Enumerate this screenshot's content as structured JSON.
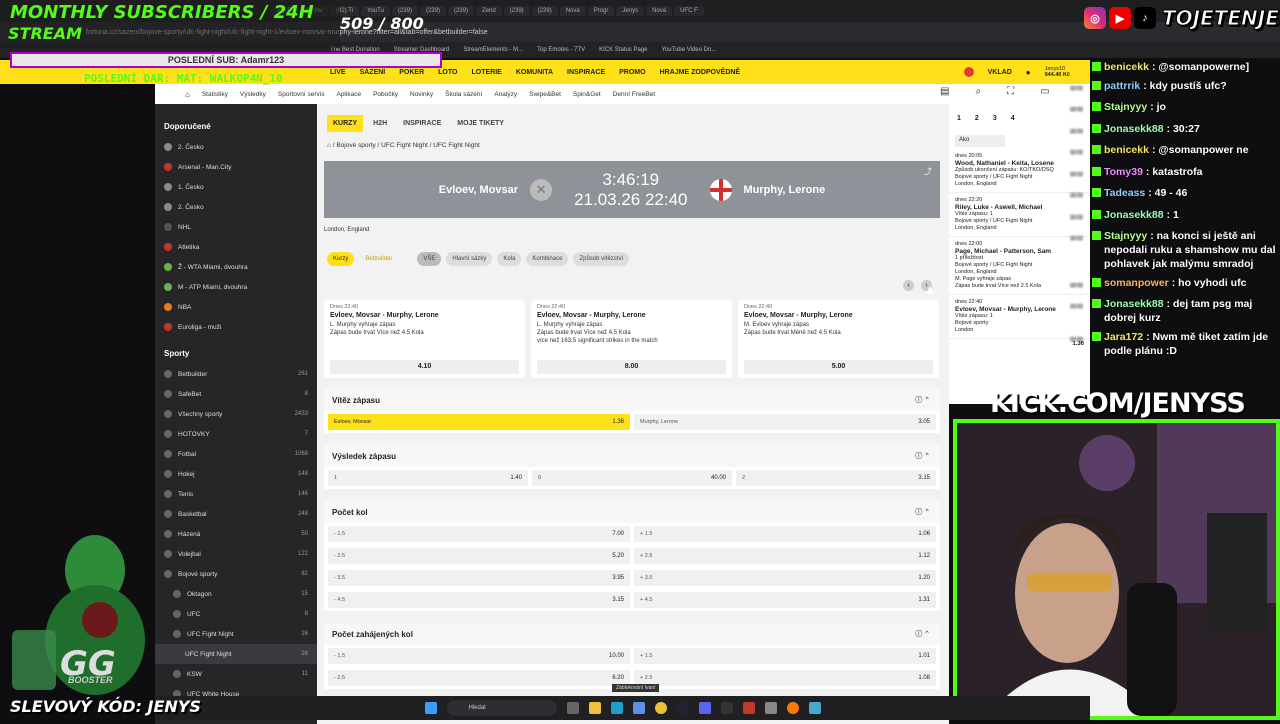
{
  "overlay": {
    "subs_title": "MONTHLY SUBSCRIBERS / 24H",
    "subs_stream": "STREAM",
    "subs_count": "509 / 800",
    "progress_label": "POSLEDNÍ SUB: Adamr123",
    "last_donation": "POSLEDNÍ DAR: MAT: WALKOP4N_10",
    "socials_handle": "TOJETENJENYS",
    "kick": "KICK.COM/JENYSS",
    "discount": "SLEVOVÝ KÓD: JENYS",
    "booster": "BOOSTER"
  },
  "browser": {
    "url": "fortuna.cz/sazeni/bojove-sporty/ufc-fight-night/ufc-fight-night-1/evloev-movsar-murphy-lerone?filter=all&tab=offer&betbuilder=false",
    "tabs": [
      "Top B",
      "(9) inv",
      "(82) Ti",
      "YouTu",
      "(239)",
      "(239)",
      "(239)",
      "Zend",
      "(239)",
      "(239)",
      "Nová",
      "Progr",
      "Jenys",
      "Nová",
      "UFC F"
    ],
    "bookmarks": [
      "The Best Donation",
      "Streamer Dashboard",
      "StreamElements - M...",
      "Top Emotes - 7TV",
      "KICK Status Page",
      "YouTube Video Do..."
    ]
  },
  "site": {
    "nav": [
      "LIVE",
      "SÁZENÍ",
      "POKER",
      "LOTO",
      "LOTERIE",
      "KOMUNITA",
      "INSPIRACE",
      "PROMO",
      "HRAJME ZODPOVĚDNĚ"
    ],
    "deposit": "VKLAD",
    "balance": "944.40 Kč",
    "user": "Jenys10",
    "subnav": [
      "Statistiky",
      "Výsledky",
      "Sportovní servis",
      "Aplikace",
      "Pobočky",
      "Novinky",
      "Škola sázení",
      "Analýzy",
      "Swipe&Bet",
      "Spin&Get",
      "Denní FreeBet"
    ]
  },
  "sidebar": {
    "recommended_title": "Doporučené",
    "recommended": [
      "2. Česko",
      "Arsenal - Man.City",
      "1. Česko",
      "2. Česko",
      "NHL",
      "Atletika",
      "Ž - WTA Miami, dvouhra",
      "M - ATP Miami, dvouhra",
      "NBA",
      "Euroliga - muži"
    ],
    "sports_title": "Sporty",
    "sports": [
      {
        "label": "Betbuilder",
        "count": "261"
      },
      {
        "label": "SafeBet",
        "count": "8"
      },
      {
        "label": "Všechny sporty",
        "count": "2433"
      },
      {
        "label": "HOTOVKY",
        "count": "7"
      },
      {
        "label": "Fotbal",
        "count": "1068"
      },
      {
        "label": "Hokej",
        "count": "148"
      },
      {
        "label": "Tenis",
        "count": "146"
      },
      {
        "label": "Basketbal",
        "count": "248"
      },
      {
        "label": "Házená",
        "count": "50"
      },
      {
        "label": "Volejbal",
        "count": "122"
      },
      {
        "label": "Bojové sporty",
        "count": "82"
      },
      {
        "label": "Oktagon",
        "count": "15"
      },
      {
        "label": "UFC",
        "count": "8"
      },
      {
        "label": "UFC Fight Night",
        "count": "26"
      },
      {
        "label": "UFC Fight Night",
        "count": "26"
      },
      {
        "label": "KSW",
        "count": "11"
      },
      {
        "label": "UFC White House",
        "count": ""
      }
    ]
  },
  "main": {
    "tabs": [
      "KURZY",
      "H2H",
      "INSPIRACE",
      "MOJE TIKETY"
    ],
    "breadcrumb": [
      "Bojové sporty",
      "UFC Fight Night",
      "UFC Fight Night"
    ],
    "player1": "Evloev, Movsar",
    "player2": "Murphy, Lerone",
    "countdown": "3:46:19",
    "datetime": "21.03.26 22:40",
    "location": "London, England",
    "mode_kurzy": "Kurzy",
    "mode_bb": "Betbuilder",
    "filters": [
      "VŠE",
      "Hlavní sázky",
      "Kola",
      "Kombinace",
      "Způsob vítězství"
    ],
    "bb_cards": [
      {
        "when": "Dnes 22:40",
        "event": "Evloev, Movsar - Murphy, Lerone",
        "legs": [
          "L. Murphy vyhraje zápas",
          "Zápas bude trvat Více než 4.5 Kola"
        ],
        "odd": "4.10"
      },
      {
        "when": "Dnes 22:40",
        "event": "Evloev, Movsar - Murphy, Lerone",
        "legs": [
          "L. Murphy vyhraje zápas",
          "Zápas bude trvat Více než 4.5 Kola",
          "více než 163.5 significant strikes in the match"
        ],
        "odd": "8.00"
      },
      {
        "when": "Dnes 22:40",
        "event": "Evloev, Movsar - Murphy, Lerone",
        "legs": [
          "M. Evloev vyhraje zápas",
          "Zápas bude trvat Méně než 4.5 Kola"
        ],
        "odd": "5.00"
      }
    ],
    "markets": [
      {
        "title": "Vítěz zápasu",
        "rows": [
          [
            {
              "l": "Evloev, Movsar",
              "v": "1.36",
              "y": true
            },
            {
              "l": "Murphy, Lerone",
              "v": "3.05"
            }
          ]
        ]
      },
      {
        "title": "Výsledek zápasu",
        "rows": [
          [
            {
              "l": "1",
              "v": "1.40"
            },
            {
              "l": "0",
              "v": "40.00"
            },
            {
              "l": "2",
              "v": "3.15"
            }
          ]
        ]
      },
      {
        "title": "Počet kol",
        "rows": [
          [
            {
              "l": "- 1.5",
              "v": "7.00"
            },
            {
              "l": "+ 1.5",
              "v": "1.06"
            }
          ],
          [
            {
              "l": "- 2.5",
              "v": "5.20"
            },
            {
              "l": "+ 2.5",
              "v": "1.12"
            }
          ],
          [
            {
              "l": "- 3.5",
              "v": "3.95"
            },
            {
              "l": "+ 3.5",
              "v": "1.20"
            }
          ],
          [
            {
              "l": "- 4.5",
              "v": "3.15"
            },
            {
              "l": "+ 4.5",
              "v": "1.31"
            }
          ]
        ]
      },
      {
        "title": "Počet zahájených kol",
        "rows": [
          [
            {
              "l": "- 1.5",
              "v": "10.00"
            },
            {
              "l": "+ 1.5",
              "v": "1.01"
            }
          ],
          [
            {
              "l": "- 2.5",
              "v": "6.20"
            },
            {
              "l": "+ 2.5",
              "v": "1.08"
            }
          ]
        ]
      }
    ]
  },
  "rightpanel": {
    "tabs": [
      "1",
      "2",
      "3",
      "4"
    ],
    "select": "Ako",
    "bets": [
      {
        "when": "dnes 20:05",
        "title": "Wood, Nathaniel - Keita, Losene",
        "lines": [
          "Způsob ukončení zápasu: KO/TKO/DSQ",
          "Bojové sporty / UFC Fight Night",
          "London, England"
        ]
      },
      {
        "when": "dnes 22:20",
        "title": "Riley, Luke - Aswell, Michael",
        "lines": [
          "Vítěz zápasu: 1",
          "Bojové sporty / UFC Fight Night",
          "London, England"
        ]
      },
      {
        "when": "dnes 22:00",
        "title": "Page, Michael - Patterson, Sam",
        "lines": [
          "1 příležitost",
          "Bojové sporty / UFC Fight Night",
          "London, England",
          "M. Page vyhraje zápas",
          "Zápas bude trvat Více než 2.5 Kola"
        ]
      },
      {
        "when": "dnes 22:40",
        "title": "Evloev, Movsar - Murphy, Lerone",
        "lines": [
          "Vítěz zápasu: 1",
          "Bojové sporty",
          "London"
        ]
      }
    ],
    "odd": "1.36"
  },
  "chat": [
    {
      "ts": "",
      "user": "benicekk",
      "msg": ": @somanpowerne]",
      "color": "#f5e663"
    },
    {
      "ts": "18:52",
      "user": "pattrrik",
      "msg": ": kdy pustíš ufc?",
      "color": "#8fd0ff"
    },
    {
      "ts": "18:52",
      "user": "Stajnyyy",
      "msg": ": jo",
      "color": "#b5ff8a"
    },
    {
      "ts": "18:52",
      "user": "Jonasekk88",
      "msg": ": 30:27",
      "color": "#9bffb0"
    },
    {
      "ts": "18:52",
      "user": "benicekk",
      "msg": ": @somanpower ne",
      "color": "#f5e663"
    },
    {
      "ts": "18:52",
      "user": "Tomy39",
      "msg": ": katastrofa",
      "color": "#f08cff"
    },
    {
      "ts": "18:52",
      "user": "Tadeass",
      "msg": ": 49 - 46",
      "color": "#8fd0ff"
    },
    {
      "ts": "18:52",
      "user": "Jonasekk88",
      "msg": ": 1",
      "color": "#9bffb0"
    },
    {
      "ts": "18:52",
      "user": "Stajnyyy",
      "msg": ": na konci si ještě ani nepodali ruku a shamshow mu dal pohlavek jak malýmu smradoj",
      "color": "#b5ff8a"
    },
    {
      "ts": "18:52",
      "user": "somanpower",
      "msg": ": ho vyhodi ufc",
      "color": "#ffb36b"
    },
    {
      "ts": "18:52",
      "user": "Jonasekk88",
      "msg": ": dej tam psg maj dobrej kurz",
      "color": "#9bffb0"
    },
    {
      "ts": "18:52",
      "user": "Jara172",
      "msg": ": Nwm mě tiket zatím jde podle plánu :D",
      "color": "#f5e663"
    }
  ],
  "taskbar": {
    "search": "Hledat",
    "tooltip": "Záblokování Ivaní"
  }
}
